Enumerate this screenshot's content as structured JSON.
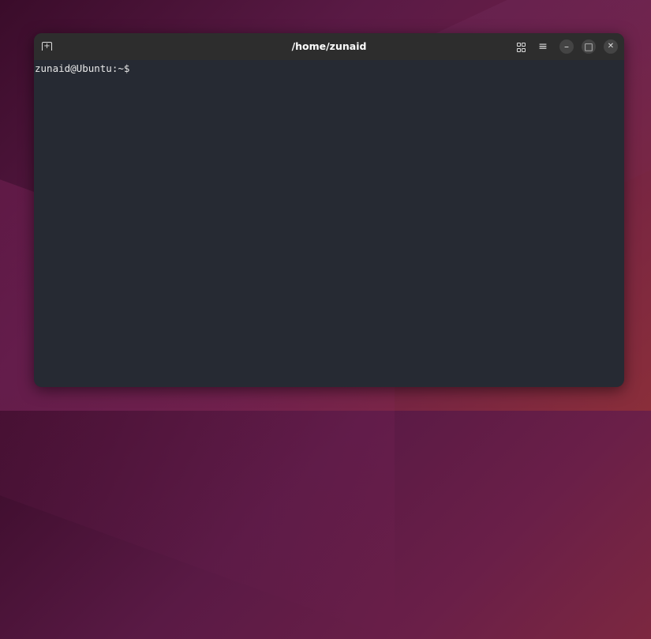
{
  "window": {
    "title": "/home/zunaid"
  },
  "terminal": {
    "prompt": "zunaid@Ubuntu:~$"
  },
  "icons": {
    "new_tab": "+",
    "minimize": "–",
    "maximize": "□",
    "close": "✕",
    "menu": "≡"
  }
}
